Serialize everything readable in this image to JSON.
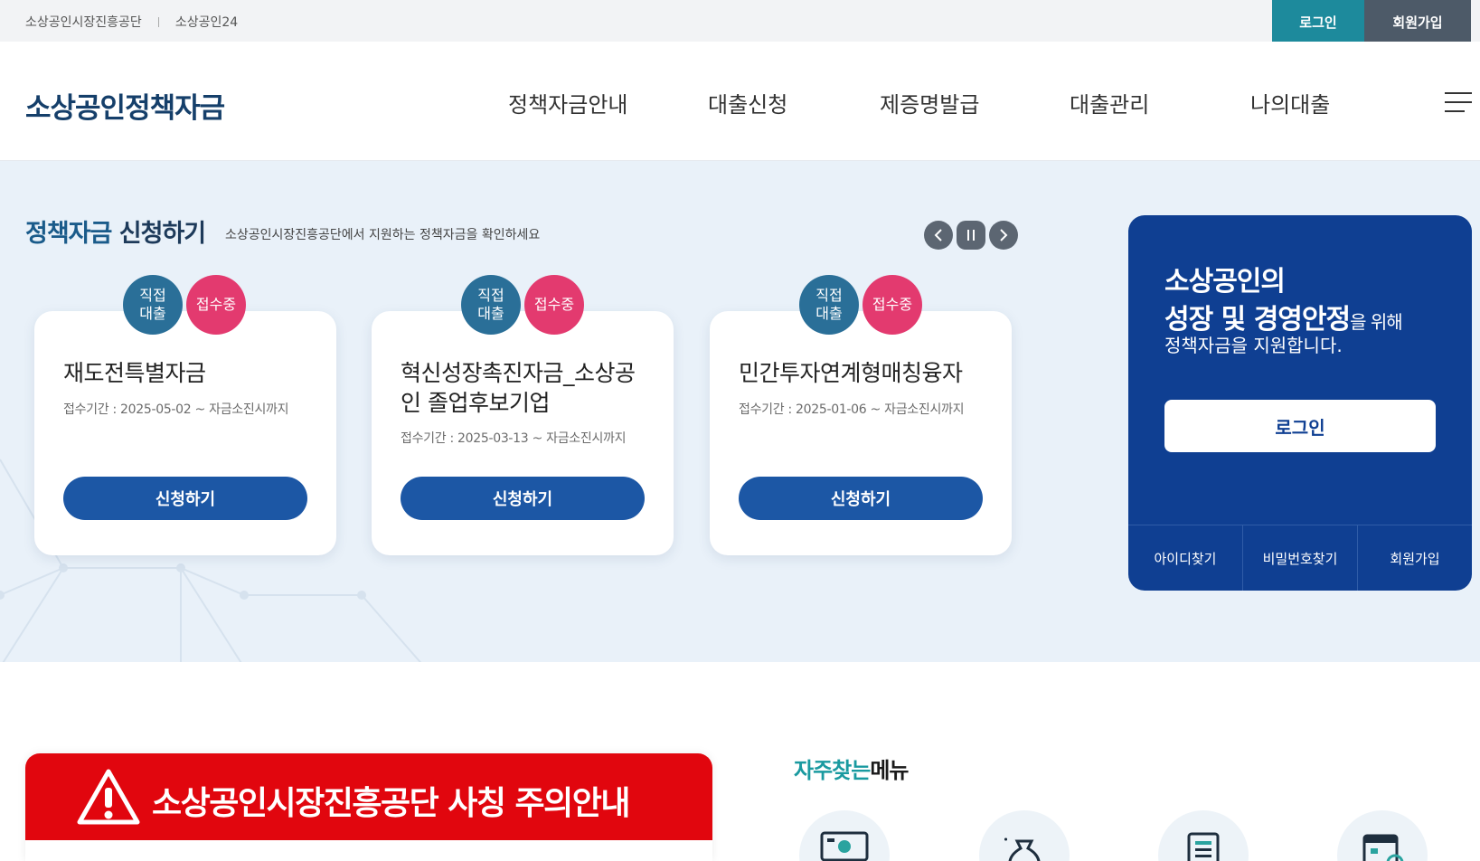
{
  "topbar": {
    "links": [
      "소상공인시장진흥공단",
      "소상공인24"
    ],
    "login_label": "로그인",
    "join_label": "회원가입"
  },
  "header": {
    "logo": "소상공인정책자금",
    "nav": [
      "정책자금안내",
      "대출신청",
      "제증명발급",
      "대출관리",
      "나의대출"
    ]
  },
  "hero": {
    "title_accent": "정책자금",
    "title_rest": " 신청하기",
    "subtitle": "소상공인시장진흥공단에서 지원하는 정책자금을 확인하세요",
    "cards": [
      {
        "badge_type": "직접\n대출",
        "badge_status": "접수중",
        "title": "재도전특별자금",
        "period": "접수기간 : 2025-05-02 ~ 자금소진시까지",
        "button": "신청하기"
      },
      {
        "badge_type": "직접\n대출",
        "badge_status": "접수중",
        "title": "혁신성장촉진자금_소상공인 졸업후보기업",
        "period": "접수기간 : 2025-03-13 ~ 자금소진시까지",
        "button": "신청하기"
      },
      {
        "badge_type": "직접\n대출",
        "badge_status": "접수중",
        "title": "민간투자연계형매칭융자",
        "period": "접수기간 : 2025-01-06 ~ 자금소진시까지",
        "button": "신청하기"
      }
    ]
  },
  "login_panel": {
    "line1": "소상공인의",
    "line2_bold": "성장 및 경영안정",
    "line2_small": "을 위해",
    "line3": "정책자금을 지원합니다.",
    "login_button": "로그인",
    "links": [
      "아이디찾기",
      "비밀번호찾기",
      "회원가입"
    ]
  },
  "notice": {
    "title": "소상공인시장진흥공단 사칭 주의안내"
  },
  "faq": {
    "title_accent": "자주찾는",
    "title_rest": "메뉴"
  },
  "colors": {
    "brand_navy": "#153f6a",
    "teal": "#1d8a9c",
    "button_blue": "#1c57a5",
    "panel_blue": "#0f3f92",
    "badge_pink": "#e33a6f",
    "alert_red": "#e1060e"
  },
  "icons": [
    "menu-icon",
    "prev-icon",
    "pause-icon",
    "next-icon",
    "warning-icon"
  ]
}
